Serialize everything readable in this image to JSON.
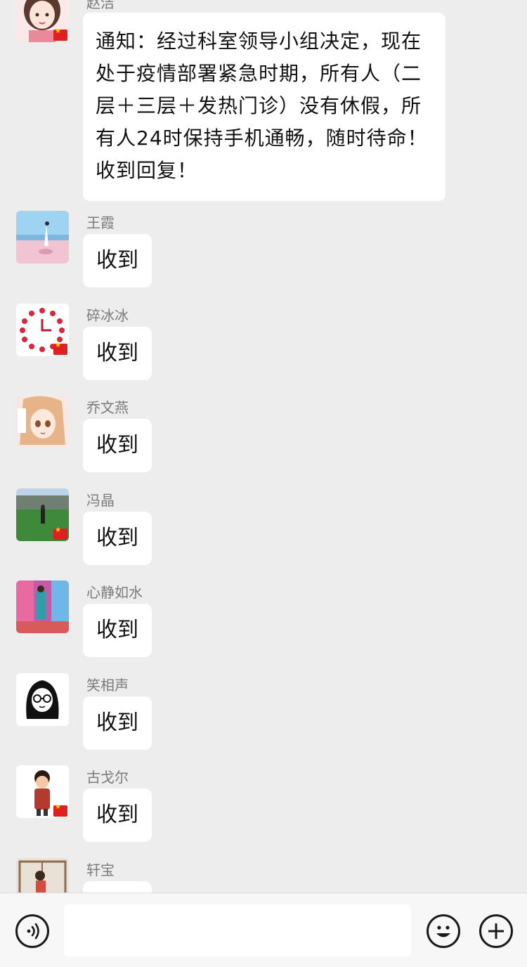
{
  "messages": [
    {
      "sender": "赵洁",
      "text": "通知：经过科室领导小组决定，现在处于疫情部署紧急时期，所有人（二层＋三层＋发热门诊）没有休假，所有人24时保持手机通畅，随时待命！收到回复！"
    },
    {
      "sender": "王霞",
      "text": "收到"
    },
    {
      "sender": "碎冰冰",
      "text": "收到"
    },
    {
      "sender": "乔文燕",
      "text": "收到"
    },
    {
      "sender": "冯晶",
      "text": "收到"
    },
    {
      "sender": "心静如水",
      "text": "收到"
    },
    {
      "sender": "笑相声",
      "text": "收到"
    },
    {
      "sender": "古戈尔",
      "text": "收到"
    },
    {
      "sender": "轩宝",
      "text": ""
    }
  ],
  "input": {
    "value": "",
    "voice_icon": "voice-icon",
    "emoji_icon": "emoji-icon",
    "add_icon": "plus-icon"
  }
}
